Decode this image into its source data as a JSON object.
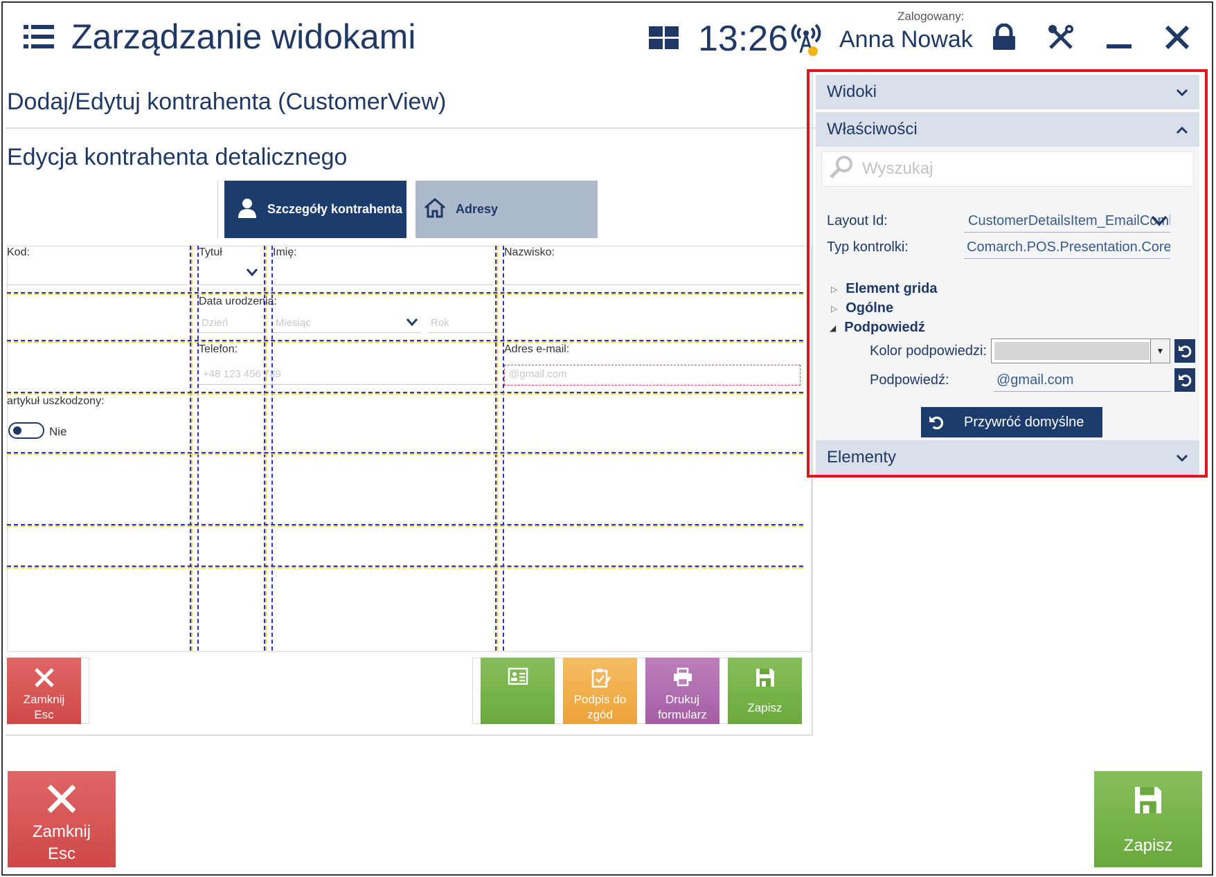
{
  "header": {
    "menu_icon": "hamburger-icon",
    "title": "Zarządzanie widokami",
    "tiles_icon": "tiles-icon",
    "time": "13:26",
    "signal_icon": "signal-icon",
    "logged_in_label": "Zalogowany:",
    "user_name": "Anna Nowak",
    "lock_icon": "lock-icon",
    "tools_icon": "tools-icon",
    "minimize_icon": "minimize-icon",
    "close_icon": "close-icon"
  },
  "view": {
    "page_title": "Dodaj/Edytuj kontrahenta (CustomerView)",
    "section_title": "Edycja kontrahenta detalicznego",
    "tabs": [
      {
        "label": "Szczegóły kontrahenta",
        "icon": "person-icon",
        "active": true
      },
      {
        "label": "Adresy",
        "icon": "house-icon",
        "active": false
      }
    ],
    "form": {
      "kod_label": "Kod:",
      "tytul_label": "Tytuł",
      "imie_label": "Imię:",
      "nazwisko_label": "Nazwisko:",
      "data_label": "Data urodzenia:",
      "dzien_placeholder": "Dzień",
      "miesiac_placeholder": "Miesiąc",
      "rok_placeholder": "Rok",
      "telefon_label": "Telefon:",
      "telefon_placeholder": "+48 123 456 789",
      "email_label": "Adres e-mail:",
      "email_placeholder": "@gmail.com",
      "damaged_label": "artykuł uszkodzony:",
      "toggle_value": "Nie"
    },
    "buttons": {
      "close_label_1": "Zamknij",
      "close_label_2": "Esc",
      "card_icon": "contact-card-icon",
      "sign_label_1": "Podpis do",
      "sign_label_2": "zgód",
      "print_label_1": "Drukuj",
      "print_label_2": "formularz",
      "save_label": "Zapisz"
    }
  },
  "footer": {
    "close_label_1": "Zamknij",
    "close_label_2": "Esc",
    "save_label": "Zapisz"
  },
  "properties_panel": {
    "widoki_label": "Widoki",
    "wlasciwosci_label": "Właściwości",
    "search_placeholder": "Wyszukaj",
    "layout_id_label": "Layout Id:",
    "layout_id_value": "CustomerDetailsItem_EmailCombo",
    "control_type_label": "Typ kontrolki:",
    "control_type_value": "Comarch.POS.Presentation.Core.Controls",
    "tree": {
      "element_grida": "Element grida",
      "ogolne": "Ogólne",
      "podpowiedz": "Podpowiedź"
    },
    "hint_color_label": "Kolor podpowiedzi:",
    "hint_label": "Podpowiedź:",
    "hint_value": "@gmail.com",
    "restore_label": "Przywróć domyślne",
    "elementy_label": "Elementy"
  }
}
